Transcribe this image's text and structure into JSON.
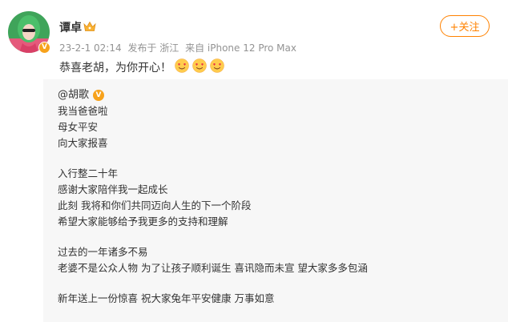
{
  "post": {
    "author": "谭卓",
    "time": "23-2-1 02:14",
    "location": "发布于 浙江",
    "device": "来自 iPhone 12 Pro Max",
    "follow_label": "+关注",
    "text": "恭喜老胡，为你开心！",
    "emojis": [
      "love-face-emoji",
      "love-face-emoji",
      "love-face-emoji"
    ]
  },
  "repost": {
    "author": "@胡歌",
    "paragraphs": [
      [
        "我当爸爸啦",
        "母女平安",
        "向大家报喜"
      ],
      [
        "入行整二十年",
        "感谢大家陪伴我一起成长",
        "此刻 我将和你们共同迈向人生的下一个阶段",
        "希望大家能够给予我更多的支持和理解"
      ],
      [
        "过去的一年诸多不易",
        "老婆不是公众人物 为了让孩子顺利诞生 喜讯隐而未宣 望大家多多包涵"
      ],
      [
        "新年送上一份惊喜 祝大家兔年平安健康 万事如意"
      ]
    ]
  },
  "colors": {
    "accent": "#ff8200",
    "verified": "#f7a21b",
    "repost_bg": "#f7f7f7",
    "meta": "#939393"
  }
}
